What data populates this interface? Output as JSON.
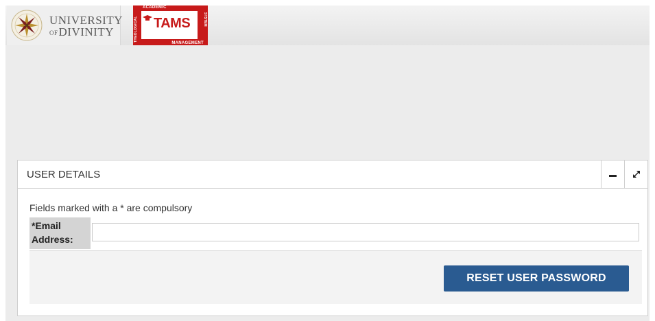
{
  "header": {
    "university_logo": {
      "line1": "UNIVERSITY",
      "line2_prefix": "OF",
      "line2": "DIVINITY",
      "icon": "university-seal-icon"
    },
    "tams_logo": {
      "word": "TAMS",
      "top_text": "ACADEMIC",
      "left_text": "THEOLOGICAL",
      "right_text": "SYSTEM",
      "bottom_text": "MANAGEMENT",
      "brand_color": "#c71a1a"
    }
  },
  "panel": {
    "title": "USER DETAILS",
    "minimize_icon": "minus-icon",
    "maximize_icon": "expand-arrows-icon",
    "note": "Fields marked with a * are compulsory",
    "email_field": {
      "label_line1": "*Email",
      "label_line2": "Address:",
      "value": "",
      "placeholder": ""
    },
    "reset_button_label": "RESET USER PASSWORD",
    "button_color": "#2a5b91"
  }
}
